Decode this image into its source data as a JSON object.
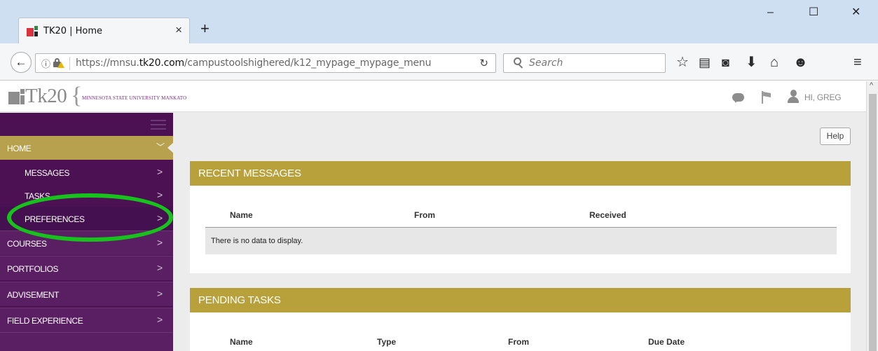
{
  "browser": {
    "tab_title": "TK20 | Home",
    "tab_close": "×",
    "new_tab": "+",
    "url_prefix": "https://mnsu.",
    "url_domain": "tk20.com",
    "url_path": "/campustoolshighered/k12_mypage_mypage_menu",
    "search_placeholder": "Search",
    "window_controls": {
      "minimize": "–",
      "maximize": "☐",
      "close": "✕"
    }
  },
  "header": {
    "logo_text": "Tk20",
    "logo_brace": "{",
    "university": "MINNESOTA STATE UNIVERSITY MANKATO",
    "greeting": "HI, GREG"
  },
  "sidebar": {
    "items": [
      {
        "label": "HOME",
        "arrow": "﹀"
      },
      {
        "label": "MESSAGES",
        "arrow": ">"
      },
      {
        "label": "TASKS",
        "arrow": ">"
      },
      {
        "label": "PREFERENCES",
        "arrow": ">"
      },
      {
        "label": "COURSES",
        "arrow": ">"
      },
      {
        "label": "PORTFOLIOS",
        "arrow": ">"
      },
      {
        "label": "ADVISEMENT",
        "arrow": ">"
      },
      {
        "label": "FIELD EXPERIENCE",
        "arrow": ">"
      }
    ]
  },
  "main": {
    "help_label": "Help",
    "recent_messages": {
      "title": "RECENT MESSAGES",
      "columns": [
        "Name",
        "From",
        "Received"
      ],
      "empty_text": "There is no data to display."
    },
    "pending_tasks": {
      "title": "PENDING TASKS",
      "columns": [
        "Name",
        "Type",
        "From",
        "Due Date"
      ]
    }
  },
  "colors": {
    "sidebar_bg": "#4b1153",
    "gold_accent": "#b8a13a",
    "highlight_ring": "#17c21d"
  }
}
